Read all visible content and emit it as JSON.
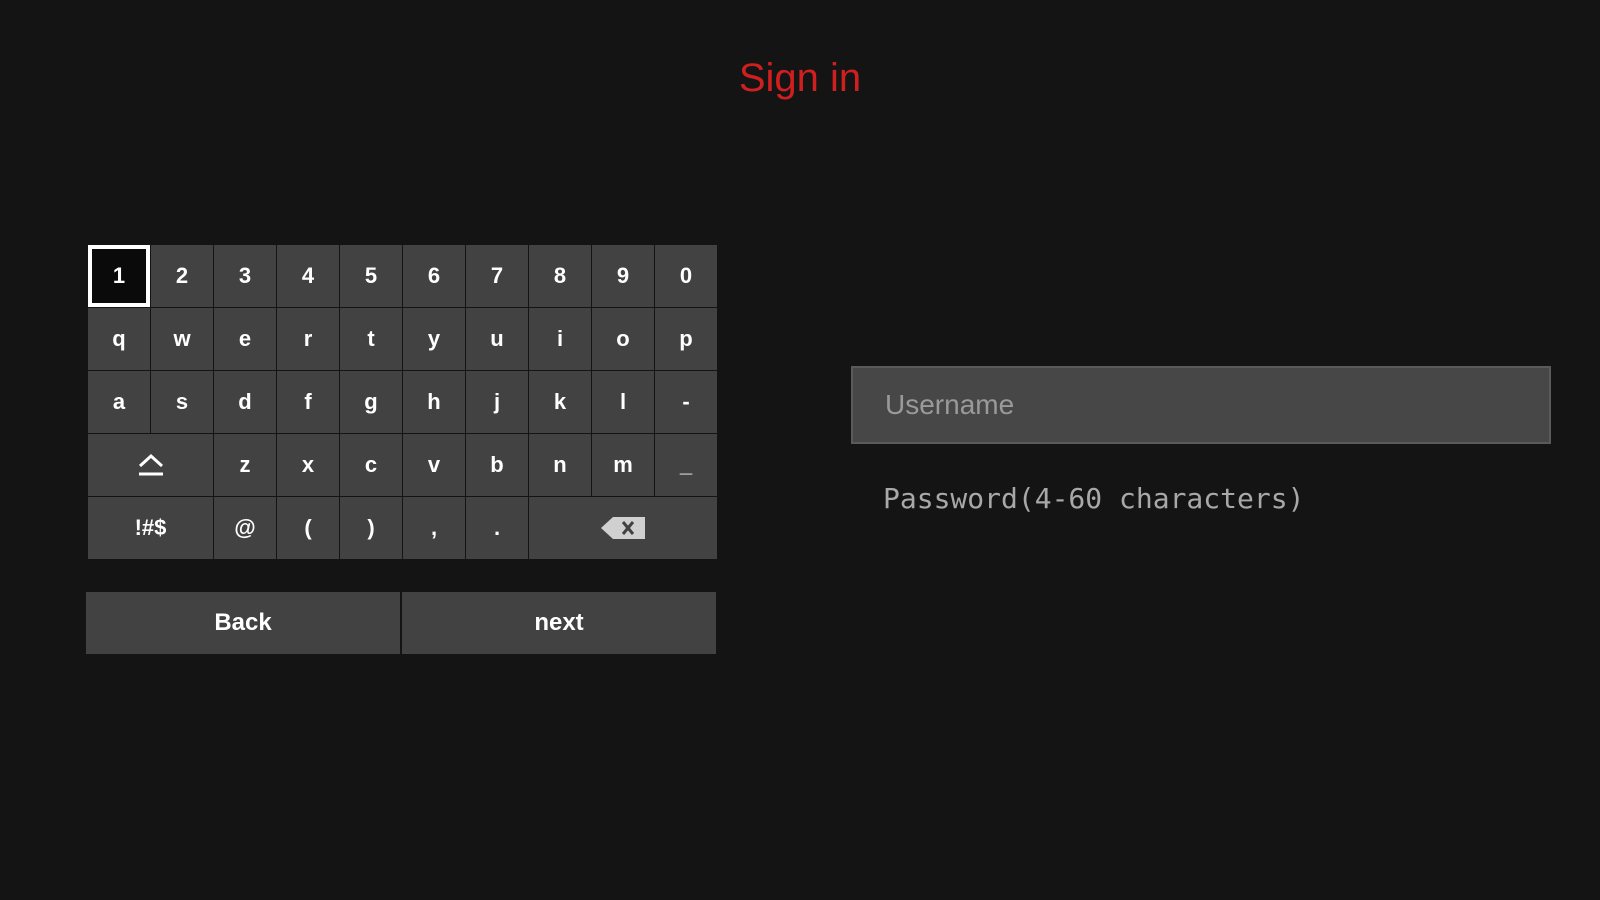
{
  "header": {
    "title": "Sign in",
    "title_color": "#d01f1f"
  },
  "keyboard": {
    "rows": [
      [
        "1",
        "2",
        "3",
        "4",
        "5",
        "6",
        "7",
        "8",
        "9",
        "0"
      ],
      [
        "q",
        "w",
        "e",
        "r",
        "t",
        "y",
        "u",
        "i",
        "o",
        "p"
      ],
      [
        "a",
        "s",
        "d",
        "f",
        "g",
        "h",
        "j",
        "k",
        "l",
        "-"
      ],
      [
        "z",
        "x",
        "c",
        "v",
        "b",
        "n",
        "m",
        "_"
      ],
      [
        "@",
        "(",
        ")",
        ",",
        "."
      ]
    ],
    "shift_icon": "shift-icon",
    "symbols_label": "!#$",
    "backspace_icon": "backspace-icon",
    "focused_key": "1"
  },
  "actions": {
    "back_label": "Back",
    "next_label": "next"
  },
  "form": {
    "username_placeholder": "Username",
    "password_placeholder": "Password(4-60 characters)"
  }
}
